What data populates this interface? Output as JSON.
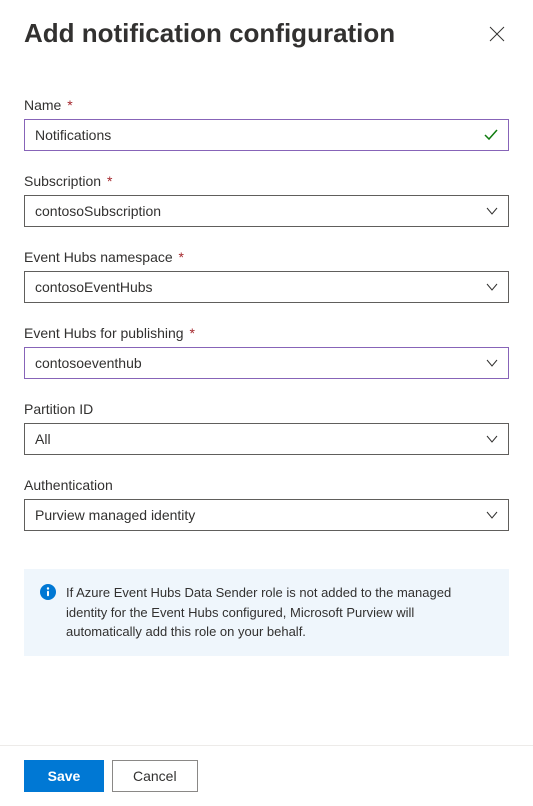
{
  "header": {
    "title": "Add notification configuration"
  },
  "form": {
    "name": {
      "label": "Name",
      "value": "Notifications",
      "required": true
    },
    "subscription": {
      "label": "Subscription",
      "value": "contosoSubscription",
      "required": true
    },
    "eventHubsNamespace": {
      "label": "Event Hubs namespace",
      "value": "contosoEventHubs",
      "required": true
    },
    "eventHubsForPublishing": {
      "label": "Event Hubs for publishing",
      "value": "contosoeventhub",
      "required": true
    },
    "partitionId": {
      "label": "Partition ID",
      "value": "All",
      "required": false
    },
    "authentication": {
      "label": "Authentication",
      "value": "Purview managed identity",
      "required": false
    }
  },
  "infoBox": {
    "text": "If Azure Event Hubs Data Sender role is not added to the managed identity for the Event Hubs configured, Microsoft Purview will automatically add this role on your behalf."
  },
  "footer": {
    "saveLabel": "Save",
    "cancelLabel": "Cancel"
  }
}
